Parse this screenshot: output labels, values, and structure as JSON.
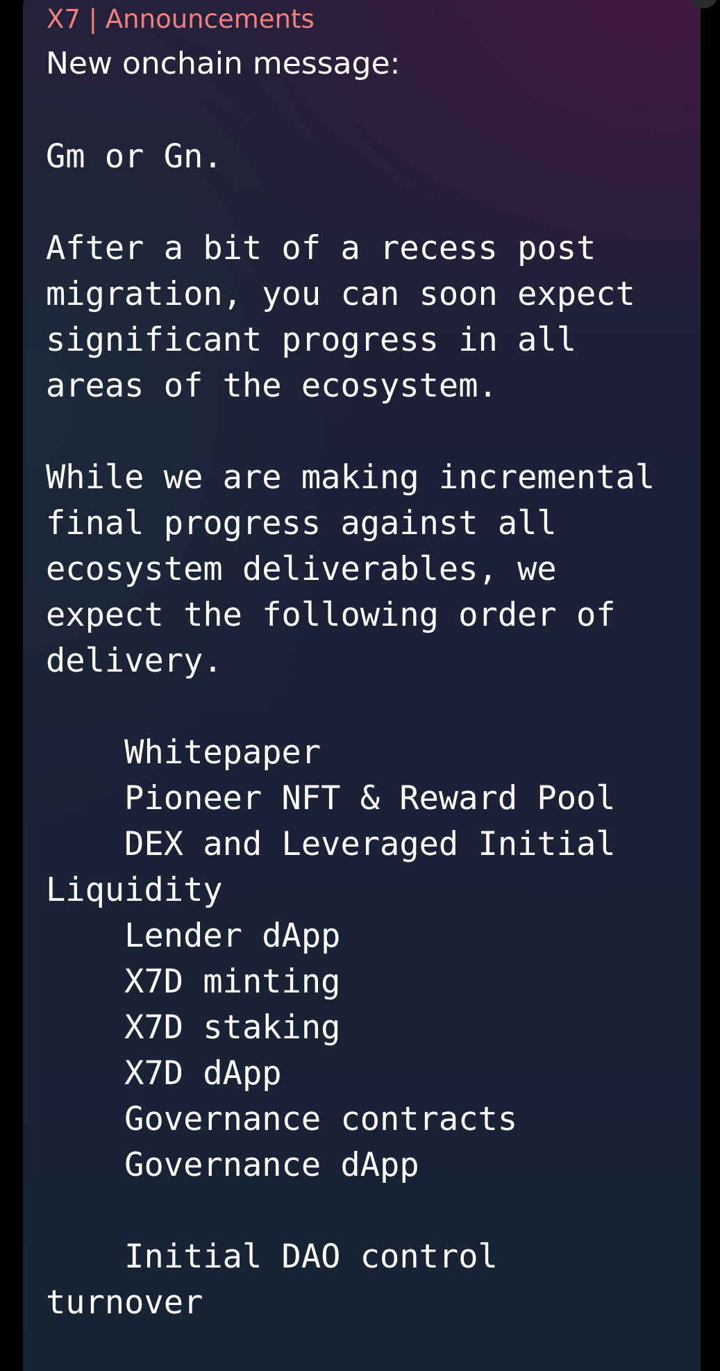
{
  "message": {
    "sender": "X7 | Announcements",
    "lead": "New onchain message:",
    "body": "Gm or Gn.\n\nAfter a bit of a recess post\nmigration, you can soon expect\nsignificant progress in all\nareas of the ecosystem.\n\nWhile we are making incremental\nfinal progress against all\necosystem deliverables, we\nexpect the following order of\ndelivery.\n\n    Whitepaper\n    Pioneer NFT & Reward Pool\n    DEX and Leveraged Initial\nLiquidity\n    Lender dApp\n    X7D minting\n    X7D staking\n    X7D dApp\n    Governance contracts\n    Governance dApp\n\n    Initial DAO control\nturnover"
  },
  "colors": {
    "sender": "#f0817e",
    "text": "#ffffff",
    "background": "#000000"
  }
}
